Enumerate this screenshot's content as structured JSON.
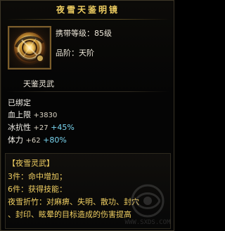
{
  "title": "夜雪天鉴明镜",
  "item": {
    "carry_level_label": "携带等级：",
    "carry_level_value": "85级",
    "tier_label": "品阶：",
    "tier_value": "天阶"
  },
  "subtitle": "天鉴灵武",
  "bind_status": "已绑定",
  "stats": [
    {
      "name": "血上限",
      "value": "+3830",
      "bonus": "",
      "pct": ""
    },
    {
      "name": "冰抗性",
      "value": "+27",
      "bonus": "",
      "pct": "+45%"
    },
    {
      "name": "体力",
      "value": "+62",
      "bonus": "",
      "pct": "+80%"
    }
  ],
  "set": {
    "name": "【夜雪灵武】",
    "lines": [
      {
        "label": "3件：",
        "desc": "命中增加；"
      },
      {
        "label": "6件：",
        "desc": "获得技能："
      },
      {
        "label": "夜雪折竹：",
        "desc": "对麻痹、失明、散功、封穴"
      },
      {
        "label": "",
        "desc": "、封印、眩晕的目标造成的伤害提高"
      }
    ]
  },
  "watermark": "WWW.SXDS.COM",
  "icons": {
    "item_icon": "mirror-icon"
  },
  "colors": {
    "title": "#f0cf62",
    "white": "#f2efe8",
    "green": "#49e06a",
    "cyan": "#7ad7f2",
    "border": "#7b5d2b",
    "bg": "#050505"
  }
}
